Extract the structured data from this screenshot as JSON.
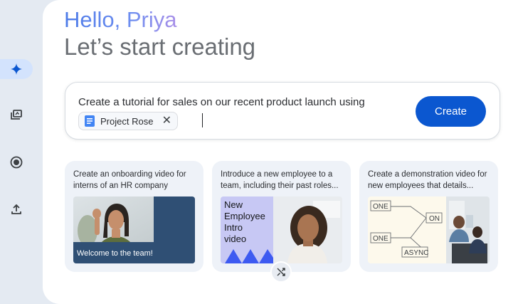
{
  "greeting": "Hello, Priya",
  "subtitle": "Let’s start creating",
  "prompt": {
    "text": "Create a tutorial for sales on our recent product launch using",
    "chip_label": "Project Rose",
    "chip_close": "✕"
  },
  "create_button": "Create",
  "cards": [
    {
      "text": "Create an onboarding video for interns of an HR company",
      "overlay_caption": "Welcome to the team!"
    },
    {
      "text": "Introduce a new employee to a team, including their past roles...",
      "thumb_title_lines": [
        "New",
        "Employee",
        "Intro",
        "video"
      ]
    },
    {
      "text": "Create a demonstration video for new employees that details...",
      "diagram_labels": [
        "ONE",
        "ON",
        "ONE",
        "ASYNC"
      ]
    }
  ],
  "icons": {
    "rail": [
      "sparkle-icon",
      "video-library-icon",
      "record-icon",
      "upload-icon"
    ],
    "chip": "document-icon",
    "shuffle": "shuffle-icon"
  },
  "colors": {
    "accent": "#0b57d0",
    "rail_active": "#d3e3fd",
    "background": "#e4eaf2",
    "card": "#eef2f8"
  }
}
